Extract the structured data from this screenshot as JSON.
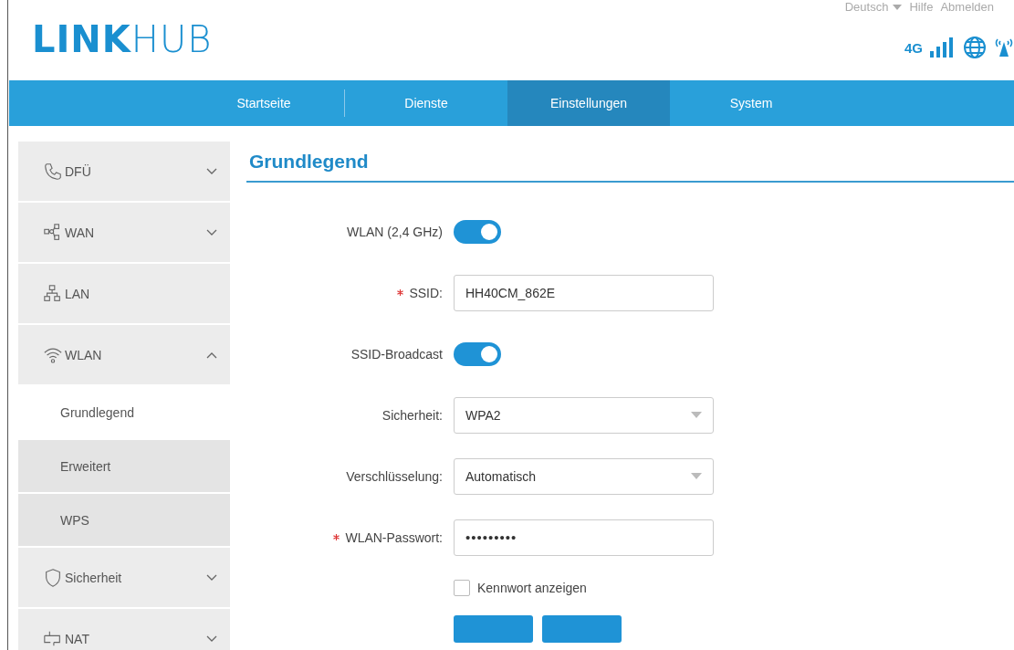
{
  "header": {
    "logo": "**LINK**HUB",
    "links": [
      {
        "label": "Deutsch",
        "dropdown": true
      },
      {
        "label": "Hilfe",
        "dropdown": false
      },
      {
        "label": "Abmelden",
        "dropdown": false
      }
    ],
    "network_type": "4G"
  },
  "nav": [
    {
      "label": "Startseite",
      "selected": false
    },
    {
      "label": "Dienste",
      "selected": false
    },
    {
      "label": "Einstellungen",
      "selected": true
    },
    {
      "label": "System",
      "selected": false
    }
  ],
  "sidebar": {
    "items": [
      {
        "label": "DFÜ",
        "expanded": false
      },
      {
        "label": "WAN",
        "expanded": false
      },
      {
        "label": "LAN"
      },
      {
        "label": "WLAN",
        "expanded": true,
        "children": [
          {
            "label": "Grundlegend",
            "selected": true
          },
          {
            "label": "Erweitert",
            "selected": false
          },
          {
            "label": "WPS",
            "selected": false
          }
        ]
      },
      {
        "label": "Sicherheit",
        "expanded": false
      },
      {
        "label": "NAT",
        "expanded": false
      }
    ]
  },
  "content": {
    "title": "Grundlegend",
    "fields": [
      {
        "kind": "toggle",
        "label": "WLAN (2,4 GHz)",
        "required": false,
        "on": true
      },
      {
        "kind": "text",
        "label": "SSID:",
        "required": true,
        "value": "HH40CM_862E"
      },
      {
        "kind": "toggle",
        "label": "SSID-Broadcast",
        "required": false,
        "on": true
      },
      {
        "kind": "select",
        "label": "Sicherheit:",
        "required": false,
        "value": "WPA2"
      },
      {
        "kind": "select",
        "label": "Verschlüsselung:",
        "required": false,
        "value": "Automatisch"
      },
      {
        "kind": "password",
        "label": "WLAN-Passwort:",
        "required": true,
        "value": "•••••••••"
      },
      {
        "kind": "checkbox",
        "label": "Kennwort anzeigen",
        "checked": false
      }
    ],
    "buttons": [
      {
        "kind": "primary"
      },
      {
        "kind": "primary"
      }
    ]
  }
}
